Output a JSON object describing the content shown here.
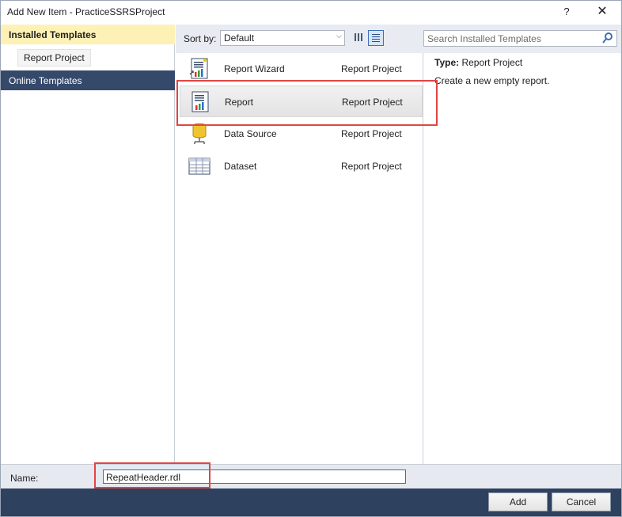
{
  "window": {
    "title": "Add New Item - PracticeSSRSProject",
    "help_glyph": "?",
    "close_glyph": "✕"
  },
  "left_pane": {
    "installed_label": "Installed Templates",
    "report_project_label": "Report Project",
    "online_label": "Online Templates"
  },
  "toolbar": {
    "sort_label": "Sort by:",
    "sort_value": "Default",
    "search_placeholder": "Search Installed Templates"
  },
  "templates": [
    {
      "name": "Report Wizard",
      "category": "Report Project",
      "icon": "report-wizard-icon"
    },
    {
      "name": "Report",
      "category": "Report Project",
      "icon": "report-icon",
      "selected": true
    },
    {
      "name": "Data Source",
      "category": "Report Project",
      "icon": "data-source-icon"
    },
    {
      "name": "Dataset",
      "category": "Report Project",
      "icon": "dataset-icon"
    }
  ],
  "details": {
    "type_label": "Type:",
    "type_value": "Report Project",
    "description": "Create a new empty report."
  },
  "name_field": {
    "label": "Name:",
    "value": "RepeatHeader.rdl"
  },
  "buttons": {
    "add": "Add",
    "cancel": "Cancel"
  },
  "colors": {
    "installed_highlight": "#fdf1b6",
    "online_bg": "#35496a",
    "footer_bg": "#2e4260",
    "annotation_red": "#e04545"
  }
}
